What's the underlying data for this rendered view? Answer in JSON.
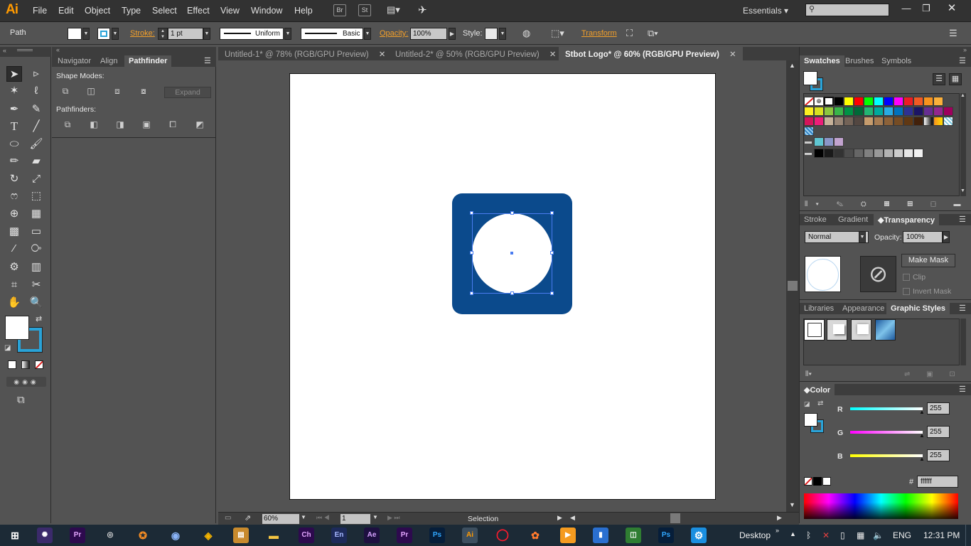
{
  "app": {
    "logo": "Ai"
  },
  "menu": [
    "File",
    "Edit",
    "Object",
    "Type",
    "Select",
    "Effect",
    "View",
    "Window",
    "Help"
  ],
  "menu_badges": [
    "Br",
    "St"
  ],
  "workspace": "Essentials",
  "control": {
    "selection_type": "Path",
    "stroke_label": "Stroke:",
    "stroke_weight": "1 pt",
    "profile": "Uniform",
    "brush": "Basic",
    "opacity_label": "Opacity:",
    "opacity_value": "100%",
    "style_label": "Style:",
    "transform_label": "Transform"
  },
  "left_panel": {
    "tabs": [
      "Navigator",
      "Align",
      "Pathfinder"
    ],
    "shape_modes": "Shape Modes:",
    "pathfinders": "Pathfinders:",
    "expand": "Expand"
  },
  "documents": [
    {
      "title": "Untitled-1* @ 78% (RGB/GPU Preview)",
      "active": false
    },
    {
      "title": "Untitled-2* @ 50% (RGB/GPU Preview)",
      "active": false
    },
    {
      "title": "Stbot Logo* @ 60% (RGB/GPU Preview)",
      "active": true
    }
  ],
  "artwork": {
    "square_color": "#0b4a8c",
    "circle_color": "#ffffff",
    "selection_color": "#4a7cf0"
  },
  "status": {
    "zoom": "60%",
    "page": "1",
    "tool": "Selection"
  },
  "swatches_panel": {
    "tabs": [
      "Swatches",
      "Brushes",
      "Symbols"
    ]
  },
  "transparency_panel": {
    "tabs": [
      "Stroke",
      "Gradient",
      "Transparency"
    ],
    "mode": "Normal",
    "opacity_label": "Opacity:",
    "opacity_value": "100%",
    "make_mask": "Make Mask",
    "clip": "Clip",
    "invert_mask": "Invert Mask"
  },
  "styles_panel": {
    "tabs": [
      "Libraries",
      "Appearance",
      "Graphic Styles"
    ]
  },
  "color_panel": {
    "title": "Color",
    "r_label": "R",
    "g_label": "G",
    "b_label": "B",
    "r": "255",
    "g": "255",
    "b": "255",
    "hex": "ffffff"
  },
  "taskbar": {
    "apps": [
      "Pr",
      "Ch",
      "En",
      "Ae",
      "Pr",
      "Ps",
      "Ai",
      "Ps"
    ],
    "desktop": "Desktop",
    "language": "ENG",
    "time": "12:31 PM"
  },
  "swatch_colors": {
    "row1": [
      "#000000",
      "#ffff00",
      "#ff0000",
      "#00ff00",
      "#00ffff",
      "#0000ff",
      "#ff00ff",
      "#ed1c24",
      "#f15a24",
      "#f7931e",
      "#fbb03b"
    ],
    "row2": [
      "#fcee21",
      "#d9e021",
      "#8cc63f",
      "#39b54a",
      "#009245",
      "#006837",
      "#22b573",
      "#00a99d",
      "#29abe2",
      "#0071bc",
      "#2e3192",
      "#1b1464",
      "#662d91",
      "#93278f",
      "#9e005d"
    ],
    "row3": [
      "#d4145a",
      "#ed1e79",
      "#c7b299",
      "#998675",
      "#736357",
      "#534741",
      "#c69c6d",
      "#a67c52",
      "#8c6239",
      "#754c24",
      "#603813",
      "#42210b"
    ],
    "row_blue": [
      "#5fc6d2",
      "#8b96c8",
      "#c2a3cf"
    ],
    "row_gray": [
      "#000000",
      "#1a1a1a",
      "#333333",
      "#4d4d4d",
      "#666666",
      "#808080",
      "#999999",
      "#b3b3b3",
      "#cccccc",
      "#e6e6e6",
      "#f2f2f2"
    ]
  }
}
